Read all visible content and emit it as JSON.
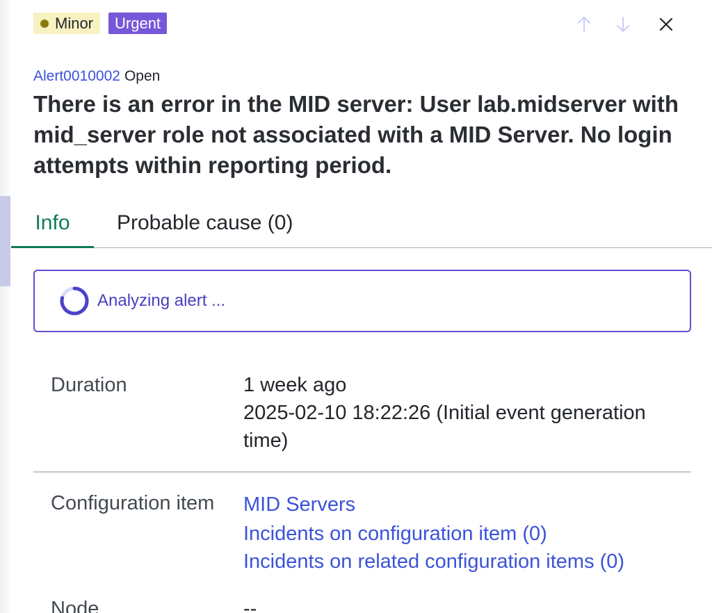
{
  "header": {
    "severity_label": "Minor",
    "priority_label": "Urgent"
  },
  "alert": {
    "id": "Alert0010002",
    "state": "Open",
    "title": "There is an error in the MID server: User lab.midserver with mid_server role not associated with a MID Server. No login attempts within reporting period."
  },
  "tabs": [
    {
      "label": "Info",
      "active": true
    },
    {
      "label": "Probable cause (0)",
      "active": false
    }
  ],
  "analysis": {
    "status_text": "Analyzing alert ..."
  },
  "details": {
    "duration": {
      "label": "Duration",
      "relative": "1 week ago",
      "absolute": "2025-02-10 18:22:26 (Initial event generation time)"
    },
    "configuration_item": {
      "label": "Configuration item",
      "links": [
        "MID Servers",
        "Incidents on configuration item (0)",
        "Incidents on related configuration items (0)"
      ]
    },
    "node": {
      "label": "Node",
      "value": "--"
    }
  },
  "colors": {
    "accent_tab": "#0f7a5a",
    "link": "#3b52d9",
    "urgent": "#7657d8",
    "minor_bg": "#f8f1c2",
    "minor_dot": "#8a7a0e",
    "analyzing": "#5b4fd2"
  },
  "icons": {
    "prev": "arrow-up-icon",
    "next": "arrow-down-icon",
    "close": "close-icon",
    "spinner": "spinner-icon"
  }
}
